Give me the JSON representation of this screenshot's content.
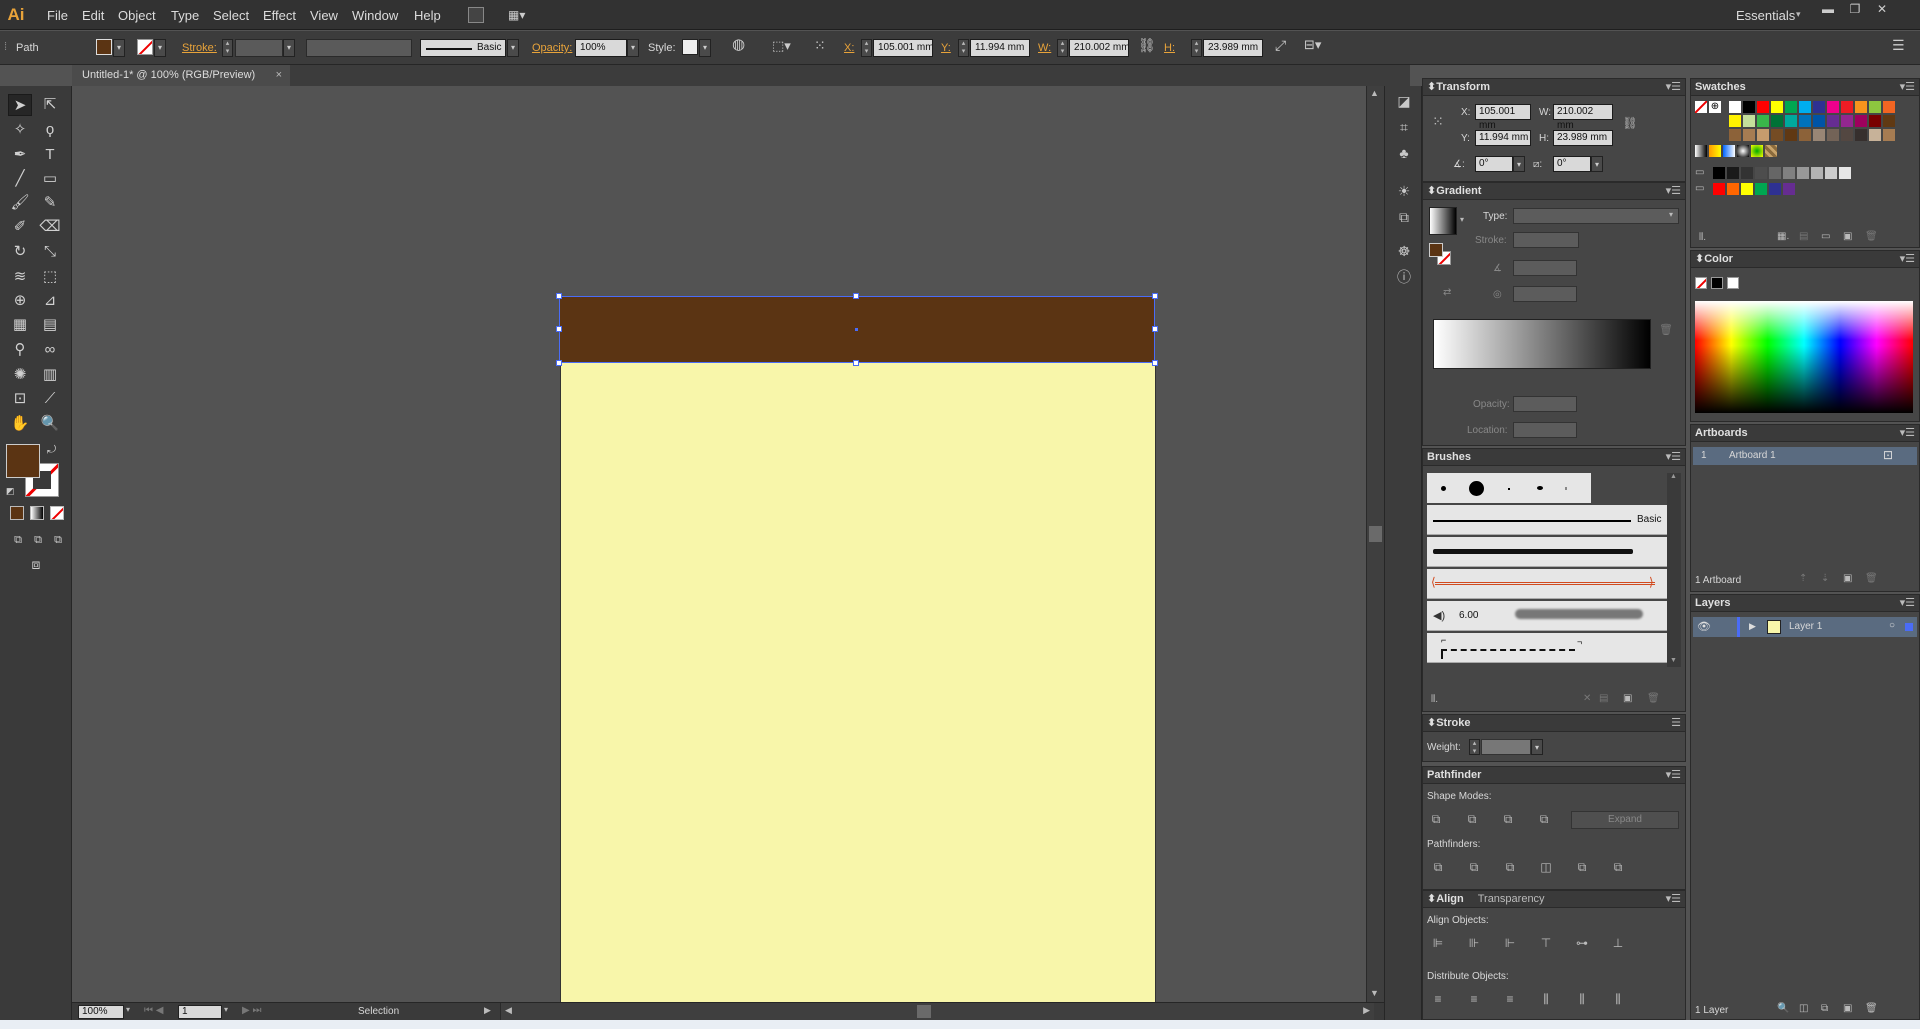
{
  "app": {
    "logo": "Ai",
    "workspace": "Essentials"
  },
  "menu": [
    "File",
    "Edit",
    "Object",
    "Type",
    "Select",
    "Effect",
    "View",
    "Window",
    "Help"
  ],
  "window_controls": {
    "minimize": "▬",
    "restore": "❐",
    "close": "✕"
  },
  "control_bar": {
    "selection_type": "Path",
    "stroke_label": "Stroke:",
    "brush_label": "Basic",
    "opacity_label": "Opacity:",
    "opacity_value": "100%",
    "style_label": "Style:",
    "x_label": "X:",
    "x_value": "105.001 mm",
    "y_label": "Y:",
    "y_value": "11.994 mm",
    "w_label": "W:",
    "w_value": "210.002 mm",
    "h_label": "H:",
    "h_value": "23.989 mm"
  },
  "document": {
    "tab_title": "Untitled-1* @ 100% (RGB/Preview)",
    "close": "×"
  },
  "artwork": {
    "header_color": "#5b3413",
    "page_color": "#f8f6aa",
    "selection_color": "#4a6cf7"
  },
  "status_bar": {
    "zoom": "100%",
    "artboard_num": "1",
    "tool": "Selection"
  },
  "transform": {
    "title": "Transform",
    "x_label": "X:",
    "x": "105.001 mm",
    "y_label": "Y:",
    "y": "11.994 mm",
    "w_label": "W:",
    "w": "210.002 mm",
    "h_label": "H:",
    "h": "23.989 mm",
    "rotate": "0°",
    "shear": "0°"
  },
  "gradient": {
    "title": "Gradient",
    "type_label": "Type:",
    "stroke_label": "Stroke:",
    "opacity_label": "Opacity:",
    "location_label": "Location:"
  },
  "brushes": {
    "title": "Brushes",
    "basic_label": "Basic",
    "size_label": "6.00"
  },
  "stroke": {
    "title": "Stroke",
    "weight_label": "Weight:"
  },
  "pathfinder": {
    "title": "Pathfinder",
    "shape_modes": "Shape Modes:",
    "expand": "Expand",
    "pathfinders": "Pathfinders:"
  },
  "align": {
    "title": "Align",
    "tab2": "Transparency",
    "align_objects": "Align Objects:",
    "distribute_objects": "Distribute Objects:"
  },
  "swatches": {
    "title": "Swatches"
  },
  "color": {
    "title": "Color"
  },
  "artboards": {
    "title": "Artboards",
    "row_num": "1",
    "row_name": "Artboard 1",
    "count": "1 Artboard"
  },
  "layers": {
    "title": "Layers",
    "layer_name": "Layer 1",
    "count": "1 Layer"
  },
  "colors": {
    "fill": "#5b3413",
    "accent": "#e8a33a",
    "panel_bg": "#464646",
    "swatch_row1": [
      "#ffffff",
      "#000000",
      "#ff0000",
      "#ffff00",
      "#00a651",
      "#00aeef",
      "#2e3192",
      "#ec008c",
      "#ed1c24",
      "#f7941d",
      "#8dc63f",
      "#f26522"
    ],
    "swatch_row2": [
      "#fff200",
      "#c4df9b",
      "#39b54a",
      "#007236",
      "#00a99d",
      "#0072bc",
      "#0054a6",
      "#662d91",
      "#92278f",
      "#9e005d",
      "#790000",
      "#603913"
    ],
    "swatch_row3": [
      "#8c6239",
      "#a67c52",
      "#c69c6d",
      "#754c24",
      "#603813",
      "#8c6239",
      "#998675",
      "#736357",
      "#534741",
      "#362f2d",
      "#c7b299",
      "#a67c52"
    ],
    "gray_row": [
      "#000000",
      "#1a1a1a",
      "#333333",
      "#4d4d4d",
      "#666666",
      "#808080",
      "#999999",
      "#b3b3b3",
      "#cccccc",
      "#e6e6e6"
    ],
    "group_row": [
      "#ff0000",
      "#ff6600",
      "#ffff00",
      "#00a651",
      "#2e3192",
      "#662d91"
    ]
  }
}
